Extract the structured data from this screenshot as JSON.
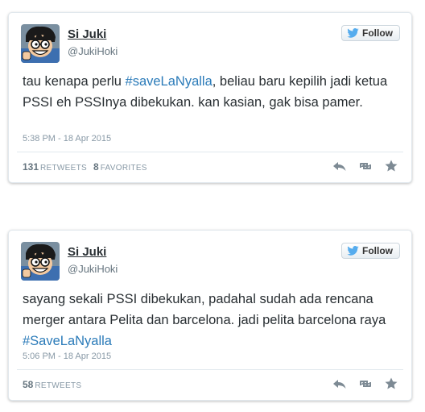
{
  "colors": {
    "hashtag": "#2b7bb9",
    "follow_bird": "#55acee",
    "action_icons": "#7d8a94"
  },
  "tweets": [
    {
      "author": {
        "name": "Si Juki",
        "handle": "@JukiHoki"
      },
      "follow_label": "Follow",
      "text_parts": [
        {
          "text": "tau kenapa perlu "
        },
        {
          "text": "#saveLaNyalla",
          "hashtag": true
        },
        {
          "text": ", beliau baru kepilih jadi ketua PSSI eh PSSInya dibekukan. kan kasian, gak bisa pamer."
        }
      ],
      "timestamp": "5:38 PM - 18 Apr 2015",
      "retweets": {
        "count": "131",
        "label": "RETWEETS"
      },
      "favorites": {
        "count": "8",
        "label": "FAVORITES"
      },
      "icons": [
        "reply-icon",
        "retweet-icon",
        "favorite-icon",
        "twitter-bird-icon"
      ]
    },
    {
      "author": {
        "name": "Si Juki",
        "handle": "@JukiHoki"
      },
      "follow_label": "Follow",
      "text_parts": [
        {
          "text": "sayang sekali PSSI dibekukan, padahal sudah ada rencana merger antara Pelita dan barcelona. jadi pelita barcelona raya "
        },
        {
          "text": "#SaveLaNyalla",
          "hashtag": true
        }
      ],
      "timestamp": "5:06 PM - 18 Apr 2015",
      "retweets": {
        "count": "58",
        "label": "RETWEETS"
      },
      "icons": [
        "reply-icon",
        "retweet-icon",
        "favorite-icon",
        "twitter-bird-icon"
      ]
    }
  ]
}
